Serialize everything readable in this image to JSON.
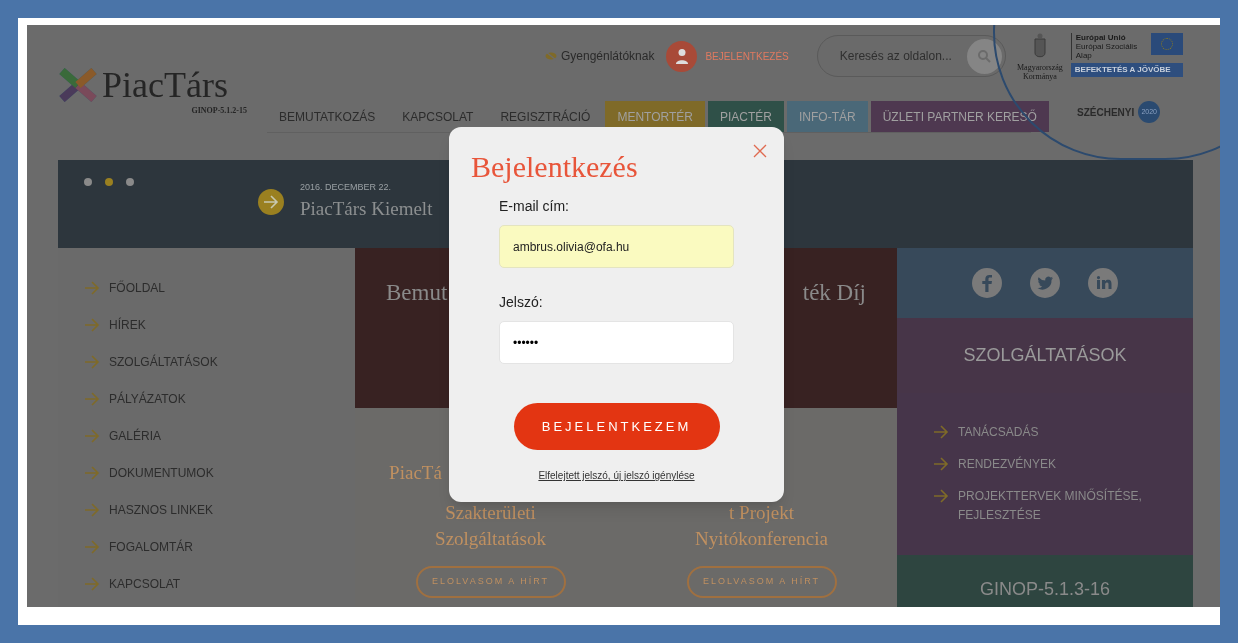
{
  "header": {
    "accessibility": "Gyengénlátóknak",
    "login": "BEJELENTKEZÉS",
    "search": {
      "placeholder": "Keresés az oldalon..."
    },
    "logo": {
      "name": "PiacTárs",
      "code": "GINOP-5.1.2-15"
    },
    "gov": {
      "line1": "Magyarország",
      "line2": "Kormánya"
    },
    "eu": {
      "line1": "Európai Unió",
      "line2": "Európai Szociális",
      "line3": "Alap",
      "slogan": "BEFEKTETÉS A JÖVŐBE"
    },
    "szechenyi": {
      "name": "SZÉCHENYI",
      "year": "2020"
    }
  },
  "nav": [
    {
      "label": "BEMUTATKOZÁS"
    },
    {
      "label": "KAPCSOLAT"
    },
    {
      "label": "REGISZTRÁCIÓ"
    },
    {
      "label": "MENTORTÉR",
      "color": "#7f6a28"
    },
    {
      "label": "PIACTÉR",
      "color": "#2f5048"
    },
    {
      "label": "INFO-TÁR",
      "color": "#4a6878"
    },
    {
      "label": "ÜZLETI PARTNER KERESŐ",
      "color": "#4e3850"
    }
  ],
  "slider": {
    "dots": [
      {
        "selected": false
      },
      {
        "selected": true
      },
      {
        "selected": false
      }
    ],
    "date": "2016. DECEMBER 22.",
    "title": "PiacTárs Kiemelt"
  },
  "sidebar": [
    "FŐOLDAL",
    "HÍREK",
    "SZOLGÁLTATÁSOK",
    "PÁLYÁZATOK",
    "GALÉRIA",
    "DOKUMENTUMOK",
    "HASZNOS LINKEK",
    "FOGALOMTÁR",
    "KAPCSOLAT"
  ],
  "feature": {
    "left": "Bemut",
    "right": "ték Díj"
  },
  "news": [
    {
      "lines": [
        "PiacTá",
        "Szakterületi",
        "Szolgáltatások"
      ],
      "button": "ELOLVASOM A HÍRT"
    },
    {
      "lines": [
        "t Projekt",
        "Nyitókonferencia"
      ],
      "button": "ELOLVASOM A HÍRT"
    }
  ],
  "services": {
    "title": "SZOLGÁLTATÁSOK",
    "items": [
      "TANÁCSADÁS",
      "RENDEZVÉNYEK",
      "PROJEKTTERVEK MINŐSÍTÉSE, FEJLESZTÉSE"
    ]
  },
  "ginop": "GINOP-5.1.3-16",
  "modal": {
    "title": "Bejelentkezés",
    "email_label": "E-mail cím:",
    "email": "ambrus.olivia@ofa.hu",
    "password_label": "Jelszó:",
    "password": "••••••",
    "submit": "BEJELENTKEZEM",
    "forgot": "Elfelejtett jelszó, új jelszó igénylése"
  }
}
